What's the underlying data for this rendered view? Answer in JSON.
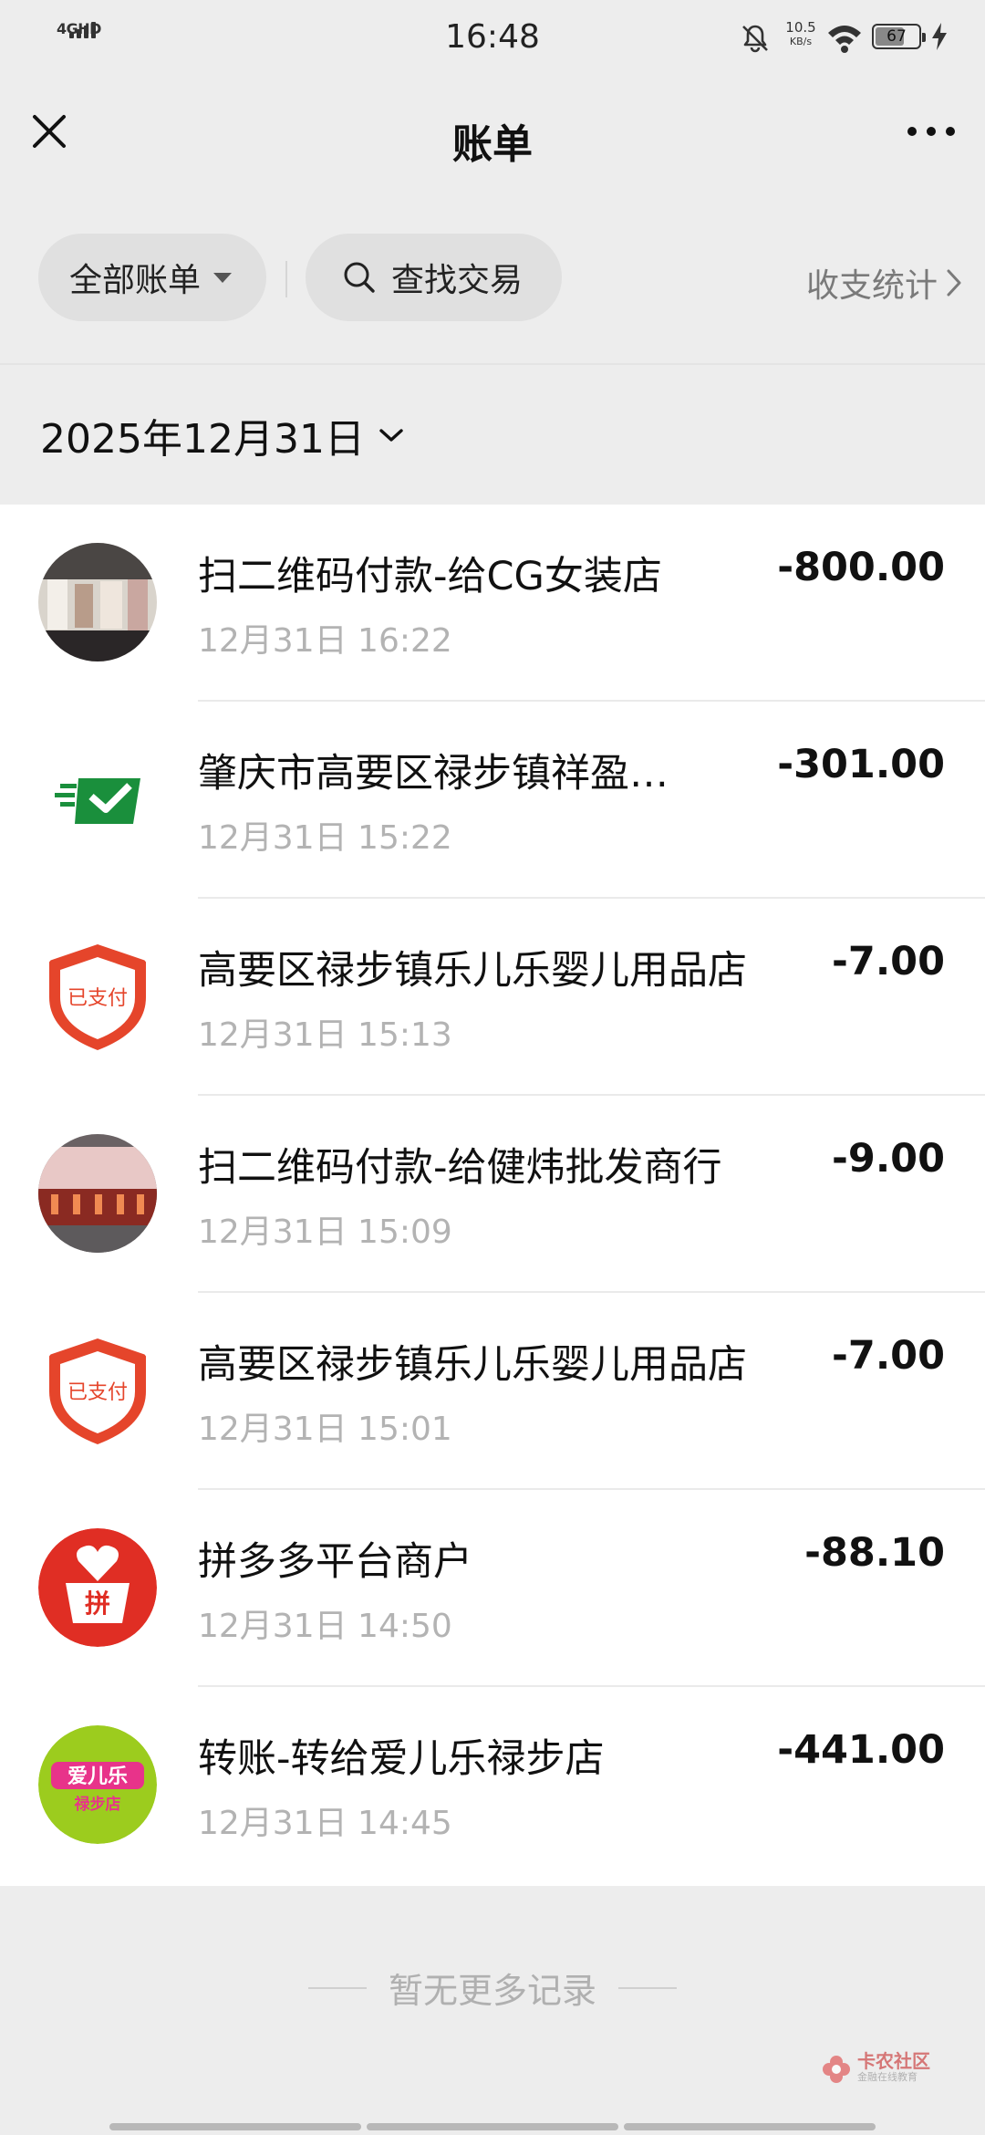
{
  "status_bar": {
    "time": "16:48",
    "network": "4GHD",
    "speed_value": "10.5",
    "speed_unit": "KB/s",
    "battery": "67",
    "battery_level": 0.67
  },
  "nav": {
    "title": "账单",
    "close_icon": "close-icon",
    "more_icon": "more-icon"
  },
  "filters": {
    "all_bills": "全部账单",
    "search": "查找交易",
    "stats": "收支统计"
  },
  "date_header": "2025年12月31日",
  "transactions": [
    {
      "title": "扫二维码付款-给CG女装店",
      "time": "12月31日 16:22",
      "amount": "-800.00",
      "avatar": "clothing-store-photo"
    },
    {
      "title": "肇庆市高要区禄步镇祥盈…",
      "time": "12月31日 15:22",
      "amount": "-301.00",
      "avatar": "green-envelope-logo"
    },
    {
      "title": "高要区禄步镇乐儿乐婴儿用品店",
      "time": "12月31日 15:13",
      "amount": "-7.00",
      "avatar": "paid-shield-logo",
      "avatar_text": "已支付"
    },
    {
      "title": "扫二维码付款-给健炜批发商行",
      "time": "12月31日 15:09",
      "amount": "-9.00",
      "avatar": "storefront-photo"
    },
    {
      "title": "高要区禄步镇乐儿乐婴儿用品店",
      "time": "12月31日 15:01",
      "amount": "-7.00",
      "avatar": "paid-shield-logo",
      "avatar_text": "已支付"
    },
    {
      "title": "拼多多平台商户",
      "time": "12月31日 14:50",
      "amount": "-88.10",
      "avatar": "pinduoduo-logo",
      "avatar_text": "拼"
    },
    {
      "title": "转账-转给爱儿乐禄步店",
      "time": "12月31日 14:45",
      "amount": "-441.00",
      "avatar": "aierle-logo",
      "avatar_text": "爱儿乐",
      "avatar_sub": "禄步店"
    }
  ],
  "footer": {
    "no_more": "暂无更多记录",
    "watermark": "卡农社区",
    "watermark_sub": "金融在线教育"
  },
  "colors": {
    "background": "#ededed",
    "list_background": "#ffffff",
    "paid_red": "#e5452b",
    "pdd_red": "#e02e24",
    "wechat_green": "#1a8f3c",
    "aierle_green": "#9ccc1e"
  }
}
